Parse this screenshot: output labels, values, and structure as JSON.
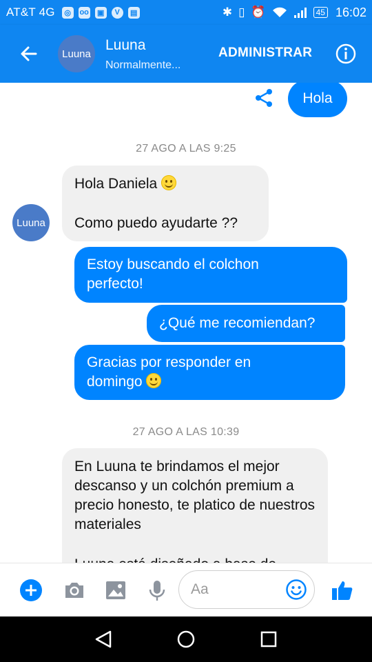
{
  "status_bar": {
    "carrier": "AT&T 4G",
    "battery": "45",
    "time": "16:02"
  },
  "header": {
    "avatar_text": "Luuna",
    "name": "Luuna",
    "status": "Normalmente...",
    "action": "ADMINISTRAR"
  },
  "chat": {
    "top_out": "Hola",
    "ts1": "27 AGO A LAS 9:25",
    "in1_line1": "Hola Daniela",
    "in1_line2": "Como puedo ayudarte ??",
    "out1": "Estoy buscando el colchon perfecto!",
    "out2": "¿Qué me recomiendan?",
    "out3": "Gracias por responder en domingo",
    "ts2": "27 AGO A LAS 10:39",
    "in2": "En Luuna te brindamos el mejor descanso y un colchón premium a precio honesto, te platico de nuestros materiales",
    "in2_cut": "Luuna está diseñado a base de",
    "avatar_text": "Luuna"
  },
  "composer": {
    "placeholder": "Aa"
  },
  "colors": {
    "brand": "#0f86f1",
    "outgoing": "#0084ff",
    "incoming": "#f0f0f0"
  }
}
